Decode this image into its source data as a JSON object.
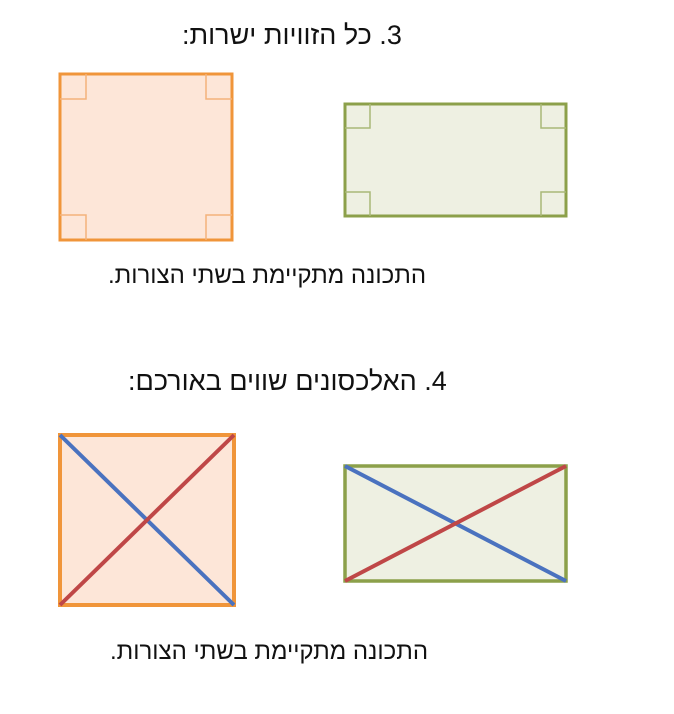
{
  "section3": {
    "heading": "3. כל הזוויות ישרות:",
    "caption": "התכונה מתקיימת בשתי הצורות."
  },
  "section4": {
    "heading": "4. האלכסונים שווים באורכם:",
    "caption": "התכונה מתקיימת בשתי הצורות."
  },
  "colors": {
    "square_stroke": "#f0953a",
    "square_fill": "#fde6d8",
    "rectangle_stroke": "#8ca04a",
    "rectangle_fill": "#eef0e2",
    "right_angle_mark_square": "#f3b27a",
    "right_angle_mark_rectangle": "#a9b878",
    "diagonal_blue": "#4a72bf",
    "diagonal_red": "#bf4747"
  }
}
